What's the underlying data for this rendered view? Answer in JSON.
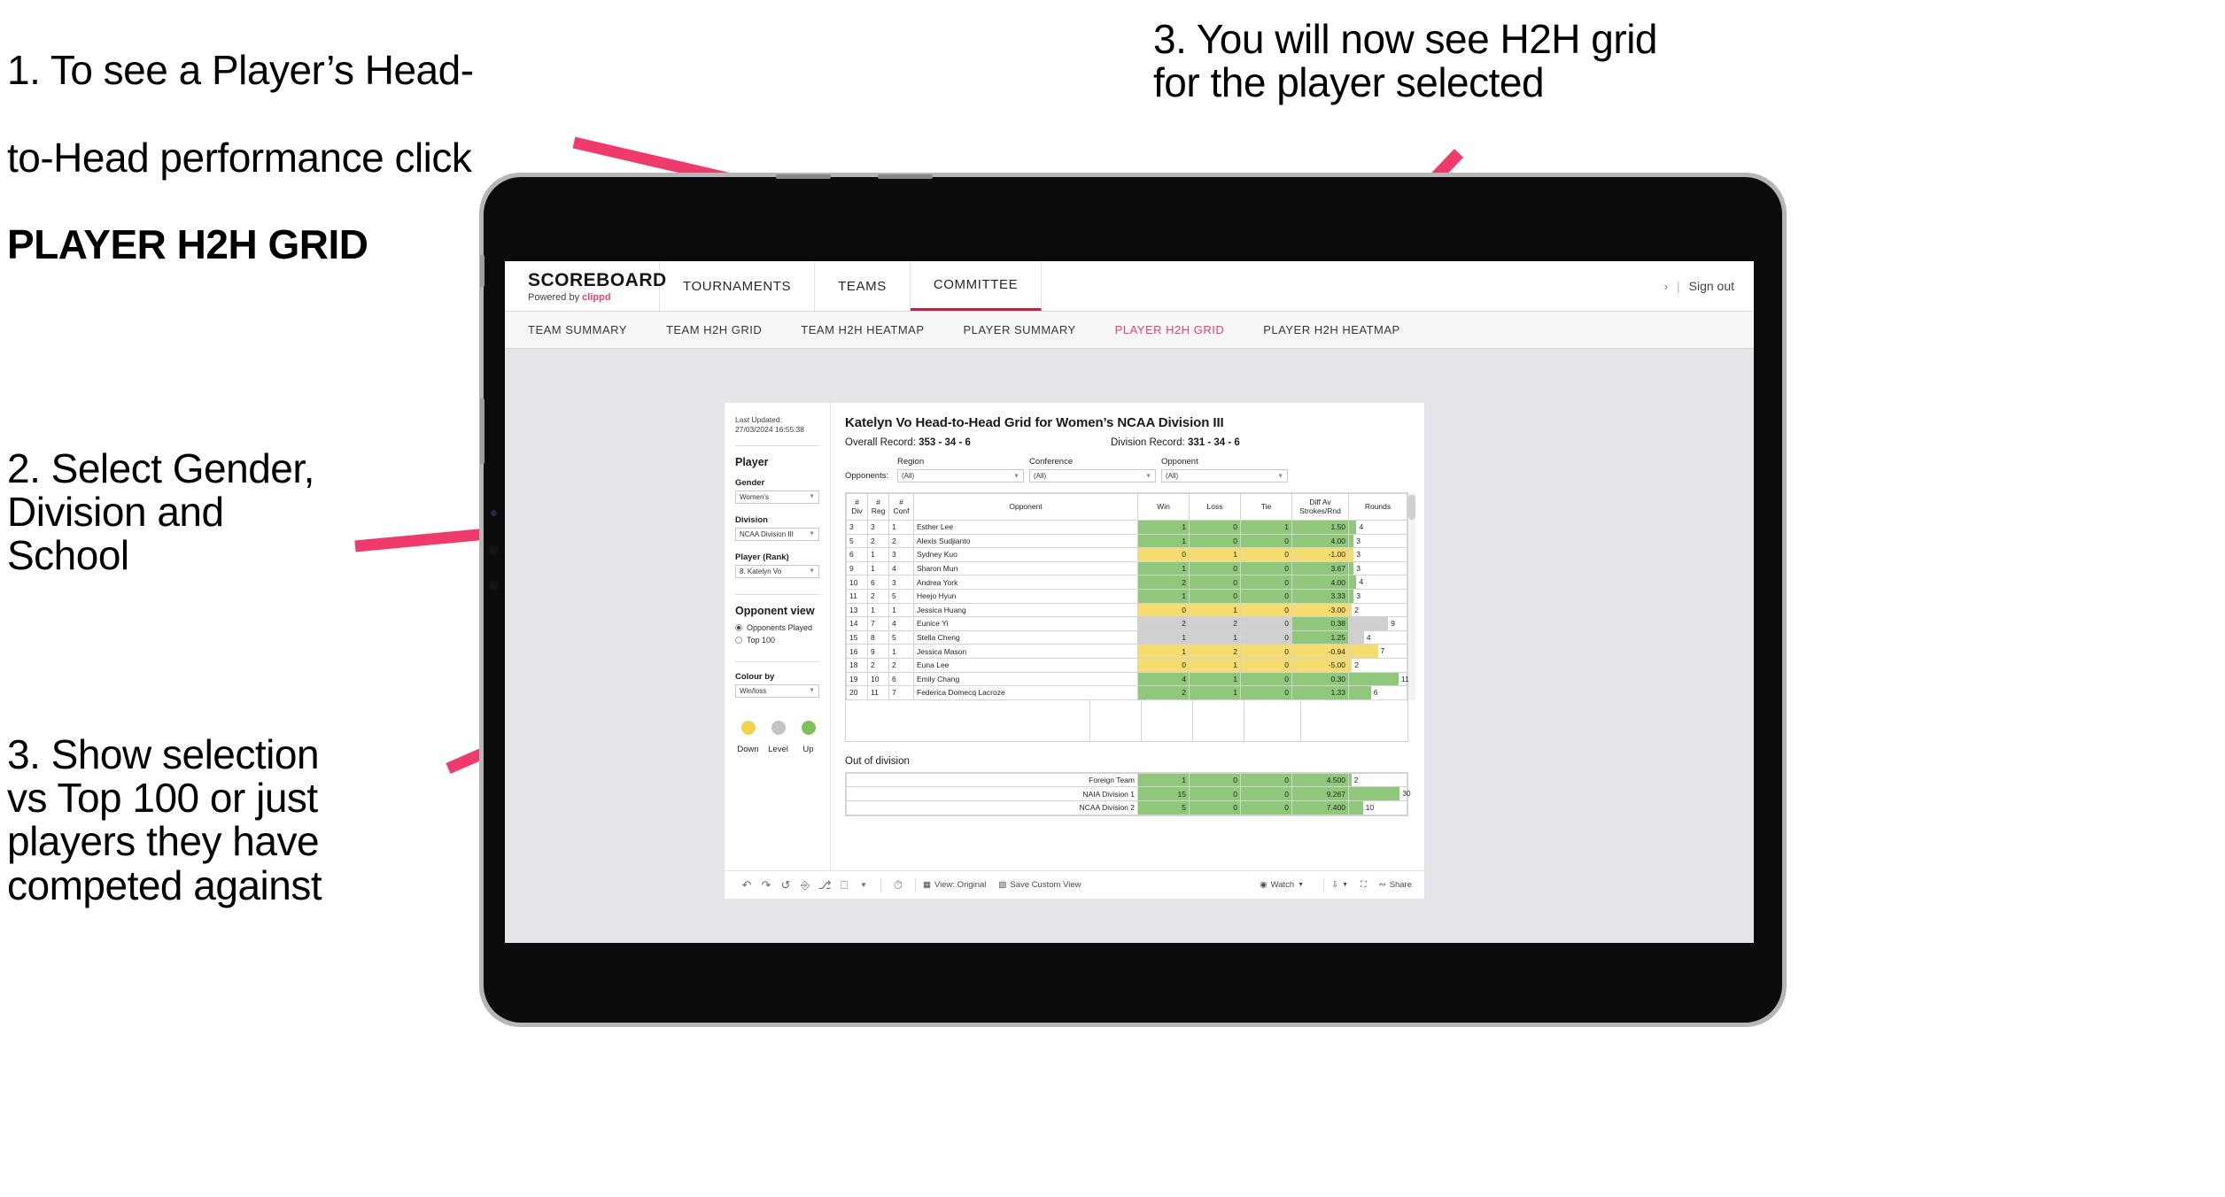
{
  "annotations": [
    {
      "id": "a1",
      "line1": "1. To see a Player’s Head-",
      "line2": "to-Head performance click",
      "line3": "PLAYER H2H GRID"
    },
    {
      "id": "a2",
      "text": "2. Select Gender,\nDivision and\nSchool"
    },
    {
      "id": "a3",
      "text": "3. Show selection\nvs Top 100 or just\nplayers they have\ncompeted against"
    },
    {
      "id": "a4",
      "text": "3. You will now see H2H grid\nfor the player selected"
    }
  ],
  "colors": {
    "accent_pink": "#e8436f",
    "brand_underline": "#c2224a",
    "arrow": "#ef3b6b",
    "green": "#8fc87a",
    "yellow": "#f5dc6e",
    "grey": "#cfcfcf"
  },
  "app": {
    "brand": {
      "title": "SCOREBOARD",
      "subtitle_prefix": "Powered by ",
      "subtitle_brand": "clippd"
    },
    "topnav": [
      {
        "label": "TOURNAMENTS",
        "active": false
      },
      {
        "label": "TEAMS",
        "active": false
      },
      {
        "label": "COMMITTEE",
        "active": true
      }
    ],
    "topnav_right": {
      "chevron": "›",
      "separator": "|",
      "sign_out": "Sign out"
    },
    "subnav": [
      {
        "label": "TEAM SUMMARY",
        "active": false
      },
      {
        "label": "TEAM H2H GRID",
        "active": false
      },
      {
        "label": "TEAM H2H HEATMAP",
        "active": false
      },
      {
        "label": "PLAYER SUMMARY",
        "active": false
      },
      {
        "label": "PLAYER H2H GRID",
        "active": true
      },
      {
        "label": "PLAYER H2H HEATMAP",
        "active": false
      }
    ]
  },
  "viz": {
    "last_updated": "Last Updated: 27/03/2024\n16:55:38",
    "sidebar": {
      "player_heading": "Player",
      "fields": [
        {
          "label": "Gender",
          "value": "Women's"
        },
        {
          "label": "Division",
          "value": "NCAA Division III"
        },
        {
          "label": "Player (Rank)",
          "value": "8. Katelyn Vo"
        }
      ],
      "opponent_view_heading": "Opponent view",
      "opponent_view_options": [
        {
          "label": "Opponents Played",
          "selected": true
        },
        {
          "label": "Top 100",
          "selected": false
        }
      ],
      "colour_by_label": "Colour by",
      "colour_by_value": "Win/loss",
      "legend": [
        {
          "label": "Down",
          "color": "#f2d34e"
        },
        {
          "label": "Level",
          "color": "#c3c3c3"
        },
        {
          "label": "Up",
          "color": "#7fc05c"
        }
      ]
    },
    "title": "Katelyn Vo Head-to-Head Grid for Women’s NCAA Division III",
    "overall_record_label": "Overall Record:",
    "overall_record_value": "353 - 34 - 6",
    "division_record_label": "Division Record:",
    "division_record_value": "331 - 34 - 6",
    "opponents_label": "Opponents:",
    "filters": [
      {
        "label": "Region",
        "value": "(All)"
      },
      {
        "label": "Conference",
        "value": "(All)"
      },
      {
        "label": "Opponent",
        "value": "(All)"
      }
    ],
    "table": {
      "headers": [
        "#\nDiv",
        "#\nReg",
        "#\nConf",
        "Opponent",
        "Win",
        "Loss",
        "Tie",
        "Diff Av\nStrokes/Rnd",
        "Rounds"
      ],
      "rows": [
        {
          "div": "3",
          "reg": "3",
          "conf": "1",
          "opponent": "Esther Lee",
          "win": "1",
          "loss": "0",
          "tie": "1",
          "diff": "1.50",
          "rounds": "4",
          "state": "up",
          "rounds_pct": 13
        },
        {
          "div": "5",
          "reg": "2",
          "conf": "2",
          "opponent": "Alexis Sudjianto",
          "win": "1",
          "loss": "0",
          "tie": "0",
          "diff": "4.00",
          "rounds": "3",
          "state": "up",
          "rounds_pct": 8
        },
        {
          "div": "6",
          "reg": "1",
          "conf": "3",
          "opponent": "Sydney Kuo",
          "win": "0",
          "loss": "1",
          "tie": "0",
          "diff": "-1.00",
          "rounds": "3",
          "state": "down",
          "rounds_pct": 8
        },
        {
          "div": "9",
          "reg": "1",
          "conf": "4",
          "opponent": "Sharon Mun",
          "win": "1",
          "loss": "0",
          "tie": "0",
          "diff": "3.67",
          "rounds": "3",
          "state": "up",
          "rounds_pct": 8
        },
        {
          "div": "10",
          "reg": "6",
          "conf": "3",
          "opponent": "Andrea York",
          "win": "2",
          "loss": "0",
          "tie": "0",
          "diff": "4.00",
          "rounds": "4",
          "state": "up",
          "rounds_pct": 13
        },
        {
          "div": "11",
          "reg": "2",
          "conf": "5",
          "opponent": "Heejo Hyun",
          "win": "1",
          "loss": "0",
          "tie": "0",
          "diff": "3.33",
          "rounds": "3",
          "state": "up",
          "rounds_pct": 8
        },
        {
          "div": "13",
          "reg": "1",
          "conf": "1",
          "opponent": "Jessica Huang",
          "win": "0",
          "loss": "1",
          "tie": "0",
          "diff": "-3.00",
          "rounds": "2",
          "state": "down",
          "rounds_pct": 5
        },
        {
          "div": "14",
          "reg": "7",
          "conf": "4",
          "opponent": "Eunice Yi",
          "win": "2",
          "loss": "2",
          "tie": "0",
          "diff": "0.38",
          "rounds": "9",
          "state": "level",
          "rounds_pct": 68
        },
        {
          "div": "15",
          "reg": "8",
          "conf": "5",
          "opponent": "Stella Cheng",
          "win": "1",
          "loss": "1",
          "tie": "0",
          "diff": "1.25",
          "rounds": "4",
          "state": "level",
          "rounds_pct": 26
        },
        {
          "div": "16",
          "reg": "9",
          "conf": "1",
          "opponent": "Jessica Mason",
          "win": "1",
          "loss": "2",
          "tie": "0",
          "diff": "-0.94",
          "rounds": "7",
          "state": "down",
          "rounds_pct": 50
        },
        {
          "div": "18",
          "reg": "2",
          "conf": "2",
          "opponent": "Euna Lee",
          "win": "0",
          "loss": "1",
          "tie": "0",
          "diff": "-5.00",
          "rounds": "2",
          "state": "down",
          "rounds_pct": 5
        },
        {
          "div": "19",
          "reg": "10",
          "conf": "6",
          "opponent": "Emily Chang",
          "win": "4",
          "loss": "1",
          "tie": "0",
          "diff": "0.30",
          "rounds": "11",
          "state": "up",
          "rounds_pct": 86
        },
        {
          "div": "20",
          "reg": "11",
          "conf": "7",
          "opponent": "Federica Domecq Lacroze",
          "win": "2",
          "loss": "1",
          "tie": "0",
          "diff": "1.33",
          "rounds": "6",
          "state": "up",
          "rounds_pct": 38
        }
      ]
    },
    "out_of_division": {
      "title": "Out of division",
      "rows": [
        {
          "name": "Foreign Team",
          "win": "1",
          "loss": "0",
          "tie": "0",
          "diff": "4.500",
          "rounds": "2",
          "state": "up",
          "rounds_pct": 4
        },
        {
          "name": "NAIA Division 1",
          "win": "15",
          "loss": "0",
          "tie": "0",
          "diff": "9.267",
          "rounds": "30",
          "state": "up",
          "rounds_pct": 88
        },
        {
          "name": "NCAA Division 2",
          "win": "5",
          "loss": "0",
          "tie": "0",
          "diff": "7.400",
          "rounds": "10",
          "state": "up",
          "rounds_pct": 24
        }
      ]
    },
    "toolbar": {
      "icons": [
        "undo-icon",
        "redo-icon",
        "revert-icon",
        "refresh-icon",
        "pause-icon",
        "zoom-icon",
        "caret-down-icon",
        "clock-icon"
      ],
      "view_label": "View: Original",
      "save_label": "Save Custom View",
      "watch_label": "Watch",
      "share_label": "Share"
    }
  }
}
